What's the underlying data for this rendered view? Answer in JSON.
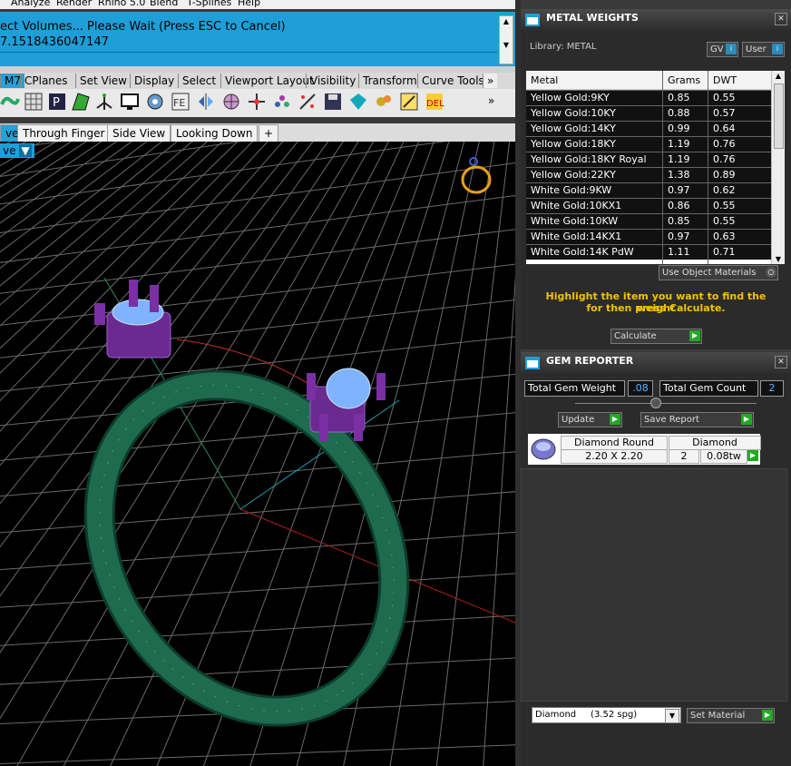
{
  "menubar": {
    "items": [
      "Analyze",
      "Render",
      "Rhino 5.0",
      "Blend",
      "T-Splines",
      "Help"
    ]
  },
  "command": {
    "line1": "ect Volumes... Please Wait (Press ESC to Cancel)",
    "line2": "7.1518436047147"
  },
  "tabs": [
    "M7",
    "CPlanes",
    "Set View",
    "Display",
    "Select",
    "Viewport Layout",
    "Visibility",
    "Transform",
    "Curve Tools"
  ],
  "tabs_more": "»",
  "toolbar_more": "»",
  "view_tabs": [
    "ve",
    "Through Finger",
    "Side View",
    "Looking Down",
    "+"
  ],
  "viewport": {
    "menu_label": "ve"
  },
  "metal_panel": {
    "title": "METAL WEIGHTS",
    "library_label": "Library: METAL",
    "gv_label": "GV",
    "user_label": "User",
    "columns": [
      "Metal",
      "Grams",
      "DWT"
    ],
    "rows": [
      [
        "Yellow Gold:9KY",
        "0.85",
        "0.55"
      ],
      [
        "Yellow Gold:10KY",
        "0.88",
        "0.57"
      ],
      [
        "Yellow Gold:14KY",
        "0.99",
        "0.64"
      ],
      [
        "Yellow Gold:18KY",
        "1.19",
        "0.76"
      ],
      [
        "Yellow Gold:18KY Royal",
        "1.19",
        "0.76"
      ],
      [
        "Yellow Gold:22KY",
        "1.38",
        "0.89"
      ],
      [
        "White Gold:9KW",
        "0.97",
        "0.62"
      ],
      [
        "White Gold:10KX1",
        "0.86",
        "0.55"
      ],
      [
        "White Gold:10KW",
        "0.85",
        "0.55"
      ],
      [
        "White Gold:14KX1",
        "0.97",
        "0.63"
      ],
      [
        "White Gold:14K PdW",
        "1.11",
        "0.71"
      ]
    ],
    "use_object_materials": "Use Object Materials",
    "info_line1": "Highlight the item you want to find the weight",
    "info_line2": "for then press Calculate.",
    "calculate_label": "Calculate"
  },
  "gem_panel": {
    "title": "GEM REPORTER",
    "total_weight_label": "Total Gem Weight",
    "total_weight_value": ".08",
    "total_count_label": "Total Gem Count",
    "total_count_value": "2",
    "update_label": "Update",
    "save_report_label": "Save Report",
    "gem": {
      "name": "Diamond Round",
      "size": "2.20 X 2.20",
      "material": "Diamond",
      "count": "2",
      "weight": "0.08tw"
    },
    "material_select": "Diamond     (3.52 spg)",
    "set_material_label": "Set Material"
  },
  "colors": {
    "accent": "#1e9fd9",
    "ring": "#1f6b50",
    "setting": "#7a2fa3",
    "stone": "#7fb3ff",
    "info": "#f2c200",
    "go": "#22aa22"
  },
  "icons": [
    "close-icon",
    "scroll-up-icon",
    "scroll-down-icon",
    "panel-icon",
    "play-icon",
    "gem-icon",
    "ring-icon"
  ]
}
